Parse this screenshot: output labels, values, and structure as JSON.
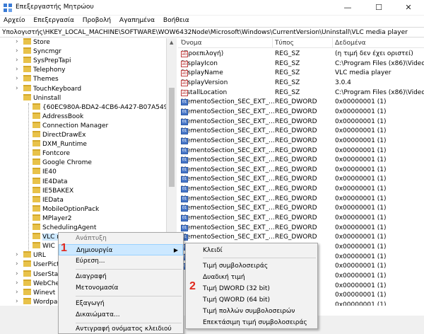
{
  "window": {
    "title": "Επεξεργαστής Μητρώου",
    "minimize": "—",
    "maximize": "☐",
    "close": "✕"
  },
  "menubar": [
    "Αρχείο",
    "Επεξεργασία",
    "Προβολή",
    "Αγαπημένα",
    "Βοήθεια"
  ],
  "address": "Υπολογιστής\\HKEY_LOCAL_MACHINE\\SOFTWARE\\WOW6432Node\\Microsoft\\Windows\\CurrentVersion\\Uninstall\\VLC media player",
  "tree": {
    "items": [
      {
        "label": "Store",
        "level": 0
      },
      {
        "label": "Syncmgr",
        "level": 0
      },
      {
        "label": "SysPrepTapi",
        "level": 0
      },
      {
        "label": "Telephony",
        "level": 0
      },
      {
        "label": "Themes",
        "level": 0
      },
      {
        "label": "TouchKeyboard",
        "level": 0
      },
      {
        "label": "Uninstall",
        "level": 0
      },
      {
        "label": "{60EC980A-BDA2-4CB6-A427-B07A5498B4CA}",
        "level": 1
      },
      {
        "label": "AddressBook",
        "level": 1
      },
      {
        "label": "Connection Manager",
        "level": 1
      },
      {
        "label": "DirectDrawEx",
        "level": 1
      },
      {
        "label": "DXM_Runtime",
        "level": 1
      },
      {
        "label": "Fontcore",
        "level": 1
      },
      {
        "label": "Google Chrome",
        "level": 1
      },
      {
        "label": "IE40",
        "level": 1
      },
      {
        "label": "IE4Data",
        "level": 1
      },
      {
        "label": "IE5BAKEX",
        "level": 1
      },
      {
        "label": "IEData",
        "level": 1
      },
      {
        "label": "MobileOptionPack",
        "level": 1
      },
      {
        "label": "MPlayer2",
        "level": 1
      },
      {
        "label": "SchedulingAgent",
        "level": 1
      },
      {
        "label": "VLC m",
        "level": 1
      },
      {
        "label": "WIC",
        "level": 1
      },
      {
        "label": "URL",
        "level": 0
      },
      {
        "label": "UserPictu",
        "level": 0
      },
      {
        "label": "UserState",
        "level": 0
      },
      {
        "label": "WebChe",
        "level": 0
      },
      {
        "label": "Winevt",
        "level": 0
      },
      {
        "label": "Wordpad",
        "level": 0
      }
    ]
  },
  "values": {
    "headers": {
      "name": "Όνομα",
      "type": "Τύπος",
      "data": "Δεδομένα"
    },
    "rows": [
      {
        "icon": "ab",
        "name": "(Προεπιλογή)",
        "type": "REG_SZ",
        "data": "(η τιμή δεν έχει οριστεί)"
      },
      {
        "icon": "ab",
        "name": "DisplayIcon",
        "type": "REG_SZ",
        "data": "C:\\Program Files (x86)\\VideoL"
      },
      {
        "icon": "ab",
        "name": "DisplayName",
        "type": "REG_SZ",
        "data": "VLC media player"
      },
      {
        "icon": "ab",
        "name": "DisplayVersion",
        "type": "REG_SZ",
        "data": "3.0.4"
      },
      {
        "icon": "ab",
        "name": "InstallLocation",
        "type": "REG_SZ",
        "data": "C:\\Program Files (x86)\\VideoL"
      },
      {
        "icon": "bin",
        "name": "MementoSection_SEC_EXT_...",
        "type": "REG_DWORD",
        "data": "0x00000001 (1)"
      },
      {
        "icon": "bin",
        "name": "MementoSection_SEC_EXT_...",
        "type": "REG_DWORD",
        "data": "0x00000001 (1)"
      },
      {
        "icon": "bin",
        "name": "MementoSection_SEC_EXT_...",
        "type": "REG_DWORD",
        "data": "0x00000001 (1)"
      },
      {
        "icon": "bin",
        "name": "MementoSection_SEC_EXT_...",
        "type": "REG_DWORD",
        "data": "0x00000001 (1)"
      },
      {
        "icon": "bin",
        "name": "MementoSection_SEC_EXT_...",
        "type": "REG_DWORD",
        "data": "0x00000001 (1)"
      },
      {
        "icon": "bin",
        "name": "MementoSection_SEC_EXT_...",
        "type": "REG_DWORD",
        "data": "0x00000001 (1)"
      },
      {
        "icon": "bin",
        "name": "MementoSection_SEC_EXT_...",
        "type": "REG_DWORD",
        "data": "0x00000001 (1)"
      },
      {
        "icon": "bin",
        "name": "MementoSection_SEC_EXT_...",
        "type": "REG_DWORD",
        "data": "0x00000001 (1)"
      },
      {
        "icon": "bin",
        "name": "MementoSection_SEC_EXT_...",
        "type": "REG_DWORD",
        "data": "0x00000001 (1)"
      },
      {
        "icon": "bin",
        "name": "MementoSection_SEC_EXT_...",
        "type": "REG_DWORD",
        "data": "0x00000001 (1)"
      },
      {
        "icon": "bin",
        "name": "MementoSection_SEC_EXT_...",
        "type": "REG_DWORD",
        "data": "0x00000001 (1)"
      },
      {
        "icon": "bin",
        "name": "MementoSection_SEC_EXT_...",
        "type": "REG_DWORD",
        "data": "0x00000001 (1)"
      },
      {
        "icon": "bin",
        "name": "MementoSection_SEC_EXT_...",
        "type": "REG_DWORD",
        "data": "0x00000001 (1)"
      },
      {
        "icon": "bin",
        "name": "MementoSection_SEC_EXT_...",
        "type": "REG_DWORD",
        "data": "0x00000001 (1)"
      },
      {
        "icon": "bin",
        "name": "MementoSection_SEC_EXT_...",
        "type": "REG_DWORD",
        "data": "0x00000001 (1)"
      },
      {
        "icon": "bin",
        "name": "MementoSection_SEC_EXT_...",
        "type": "REG_DWORD",
        "data": "0x00000001 (1)"
      },
      {
        "icon": "bin",
        "name": "MementoSection_SEC_EXT_...",
        "type": "REG_DWORD",
        "data": "0x00000001 (1)"
      },
      {
        "icon": "bin",
        "name": "",
        "type": "",
        "data": "0x00000001 (1)"
      },
      {
        "icon": "",
        "name": "",
        "type": "",
        "data": "0x00000001 (1)"
      },
      {
        "icon": "",
        "name": "",
        "type": "",
        "data": "0x00000001 (1)"
      },
      {
        "icon": "",
        "name": "",
        "type": "",
        "data": "0x00000001 (1)"
      },
      {
        "icon": "",
        "name": "",
        "type": "",
        "data": "0x00000001 (1)"
      },
      {
        "icon": "",
        "name": "",
        "type": "",
        "data": "0x00000001 (1)"
      }
    ]
  },
  "context_menu": {
    "expand": "Ανάπτυξη",
    "new": "Δημιουργία",
    "find": "Εύρεση...",
    "delete": "Διαγραφή",
    "rename": "Μετονομασία",
    "export": "Εξαγωγή",
    "permissions": "Δικαιώματα...",
    "copy_key_name": "Αντιγραφή ονόματος κλειδιού",
    "marker": "1"
  },
  "submenu": {
    "key": "Κλειδί",
    "string": "Τιμή συμβολοσειράς",
    "binary": "Δυαδική τιμή",
    "dword": "Τιμή DWORD (32 bit)",
    "qword": "Τιμή QWORD (64 bit)",
    "multi_string": "Τιμή πολλών συμβολοσειρών",
    "expand_string": "Επεκτάσιμη τιμή συμβολοσειράς",
    "marker": "2"
  }
}
